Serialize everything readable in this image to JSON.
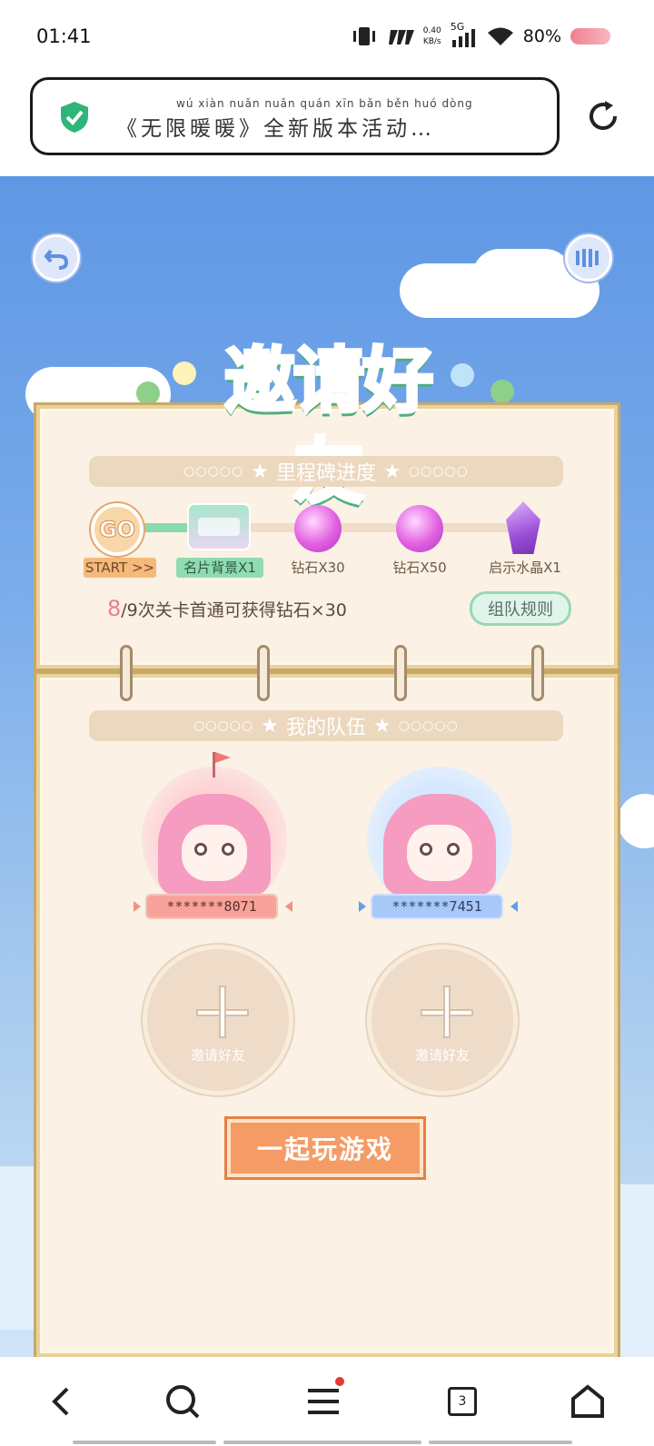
{
  "status_bar": {
    "time": "01:41",
    "net_speed_value": "0.40",
    "net_speed_unit": "KB/s",
    "network": "5G",
    "battery_pct": "80%",
    "icons": [
      "vibrate-icon",
      "hd-icon",
      "signal-icon",
      "wifi-icon",
      "battery-icon"
    ]
  },
  "url_bar": {
    "pinyin": "wú xiàn nuǎn nuǎn   quán xīn bǎn běn huó dòng",
    "title": "《无限暖暖》全新版本活动…",
    "security_icon": "shield-check-icon",
    "reload_icon": "reload-icon"
  },
  "game": {
    "title": "邀请好友",
    "back_icon": "back-icon",
    "music_icon": "music-icon",
    "milestone": {
      "header": "里程碑进度",
      "nodes": [
        {
          "icon": "go-badge-icon",
          "badge": "GO",
          "label": "START >>"
        },
        {
          "icon": "card-background-icon",
          "label": "名片背景X1"
        },
        {
          "icon": "diamond-icon",
          "label": "钻石X30"
        },
        {
          "icon": "diamond-icon",
          "label": "钻石X50"
        },
        {
          "icon": "crystal-icon",
          "label": "启示水晶X1"
        }
      ],
      "progress_num": "8",
      "progress_text": "/9次关卡首通可获得钻石×30",
      "rules_button": "组队规则"
    },
    "team": {
      "header": "我的队伍",
      "members": [
        {
          "name": "*******8071",
          "theme": "pink"
        },
        {
          "name": "*******7451",
          "theme": "blue"
        }
      ],
      "invite_label": "邀请好友",
      "play_button": "一起玩游戏"
    },
    "colors": {
      "sky": "#6a9fe6",
      "panel": "#fbf1e4",
      "title_green": "#7ad7a4",
      "accent_orange": "#f59b66"
    }
  },
  "bottom_nav": {
    "tab_count": "3",
    "icons": [
      "back-arrow-icon",
      "search-icon",
      "menu-icon",
      "tabs-icon",
      "home-icon"
    ]
  }
}
